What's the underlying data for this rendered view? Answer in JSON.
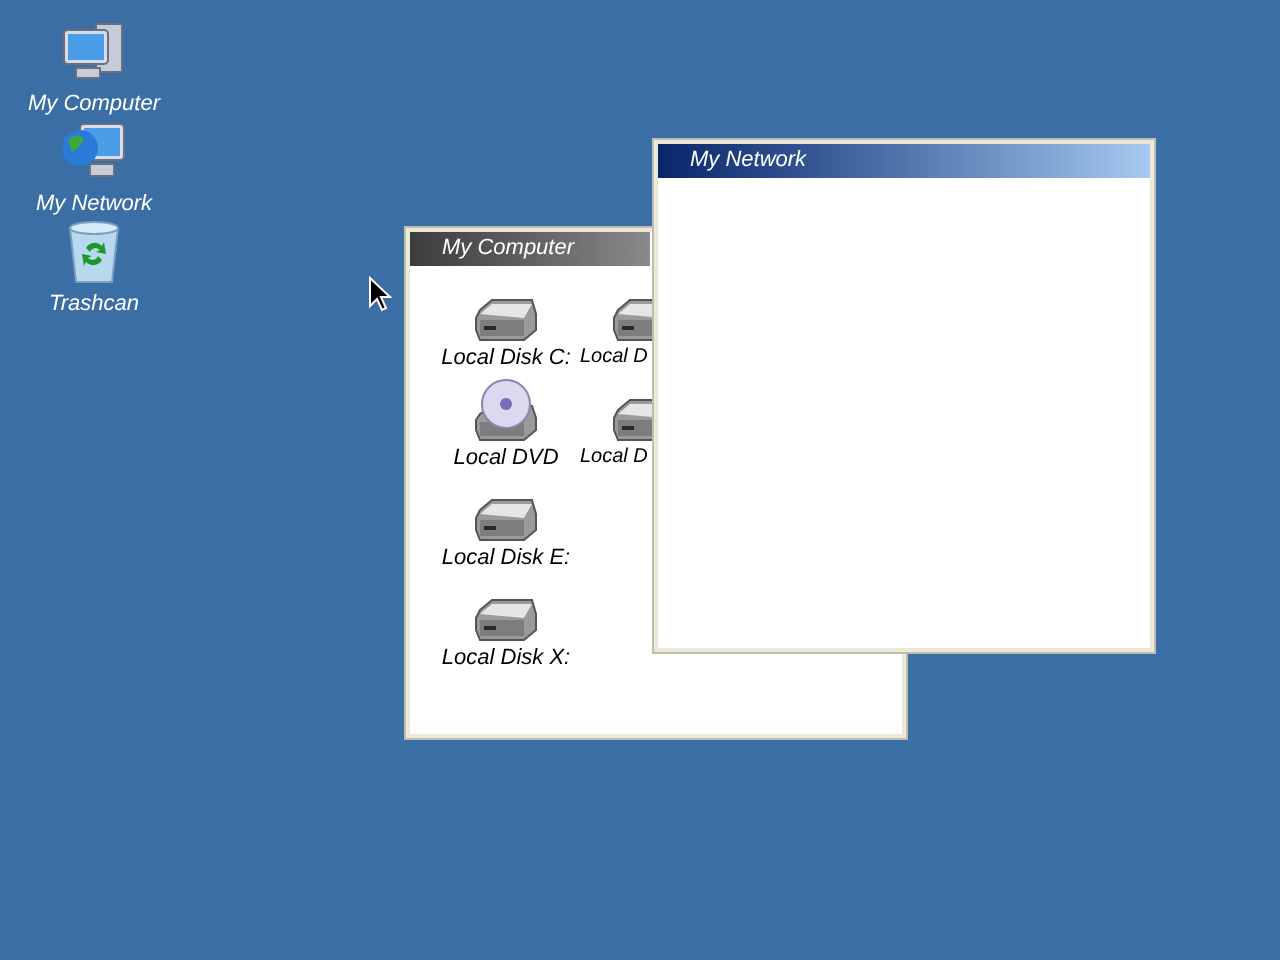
{
  "desktop_icons": [
    {
      "kind": "computer",
      "label": "My Computer"
    },
    {
      "kind": "network",
      "label": "My Network"
    },
    {
      "kind": "trash",
      "label": "Trashcan"
    }
  ],
  "windows": [
    {
      "title": "My Computer",
      "active": false,
      "rows": [
        [
          {
            "kind": "disk",
            "label": "Local Disk C:"
          },
          {
            "kind": "disk",
            "label": "Local D"
          }
        ],
        [
          {
            "kind": "dvd",
            "label": "Local DVD"
          },
          {
            "kind": "disk",
            "label": "Local D"
          }
        ],
        [
          {
            "kind": "disk",
            "label": "Local Disk E:"
          }
        ],
        [
          {
            "kind": "disk",
            "label": "Local Disk X:"
          }
        ]
      ]
    },
    {
      "title": "My Network",
      "active": true
    }
  ]
}
